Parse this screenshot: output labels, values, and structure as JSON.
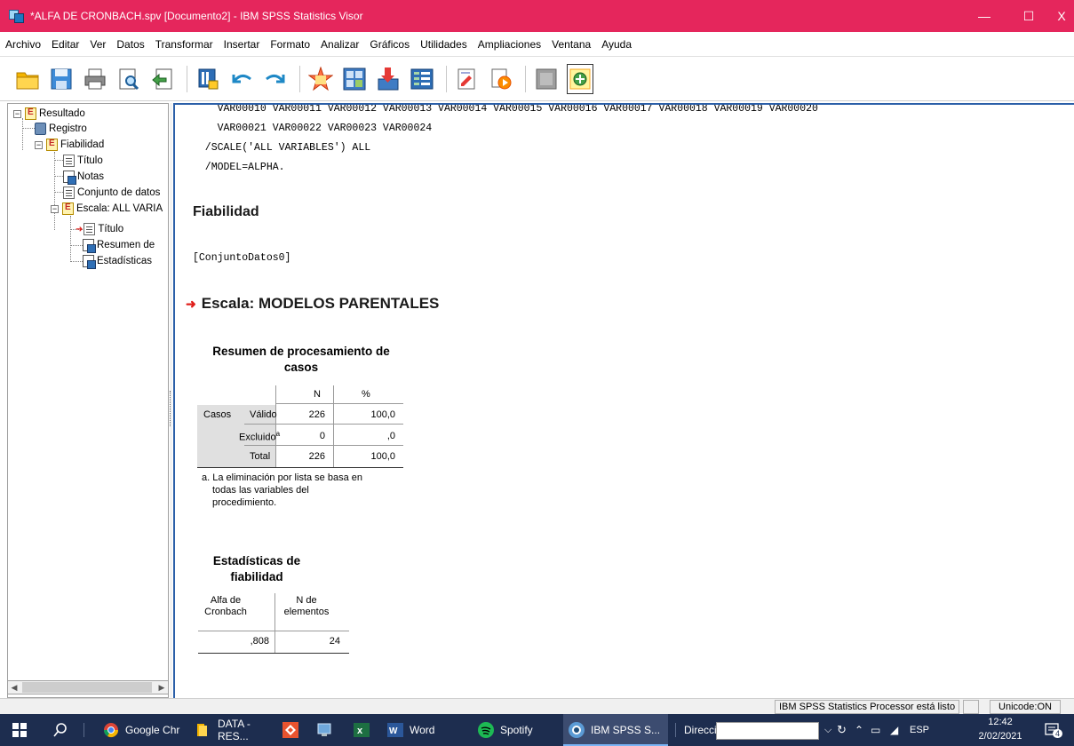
{
  "window": {
    "title": "*ALFA DE CRONBACH.spv [Documento2] - IBM SPSS Statistics Visor",
    "controls": {
      "minimize": "—",
      "maximize": "☐",
      "close": "X"
    }
  },
  "menu": [
    "Archivo",
    "Editar",
    "Ver",
    "Datos",
    "Transformar",
    "Insertar",
    "Formato",
    "Analizar",
    "Gráficos",
    "Utilidades",
    "Ampliaciones",
    "Ventana",
    "Ayuda"
  ],
  "toolbar_icons": [
    "open-icon",
    "save-icon",
    "print-icon",
    "print-preview-icon",
    "export-icon",
    "recall-dialog-icon",
    "undo-icon",
    "redo-icon",
    "goto-data-icon",
    "goto-case-icon",
    "insert-output-icon",
    "variables-icon",
    "designate-window-icon",
    "select-last-output-icon",
    "inactive-icon",
    "show-hide-icon"
  ],
  "outline": {
    "root": "Resultado",
    "log": "Registro",
    "procedure": "Fiabilidad",
    "titulo": "Título",
    "notas": "Notas",
    "dataset": "Conjunto de datos",
    "scale": "Escala: ALL VARIA",
    "scale_title": "Título",
    "summary": "Resumen de",
    "stats": "Estadísticas"
  },
  "content": {
    "syntax_lines": [
      "    VAR00010 VAR00011 VAR00012 VAR00013 VAR00014 VAR00015 VAR00016 VAR00017 VAR00018 VAR00019 VAR00020",
      "    VAR00021 VAR00022 VAR00023 VAR00024",
      "  /SCALE('ALL VARIABLES') ALL",
      "  /MODEL=ALPHA."
    ],
    "heading": "Fiabilidad",
    "dataset_label": "[ConjuntoDatos0]",
    "scale_heading": "Escala: MODELOS PARENTALES",
    "case_summary": {
      "title_line1": "Resumen de procesamiento de",
      "title_line2": "casos",
      "col_n": "N",
      "col_pct": "%",
      "row_group": "Casos",
      "rows": [
        {
          "label": "Válido",
          "n": "226",
          "pct": "100,0"
        },
        {
          "label": "Excluido",
          "sup": "a",
          "n": "0",
          "pct": ",0"
        },
        {
          "label": "Total",
          "n": "226",
          "pct": "100,0"
        }
      ],
      "footnote_line1": "a. La eliminación por lista se basa en",
      "footnote_line2": "todas las variables del",
      "footnote_line3": "procedimiento."
    },
    "reliability": {
      "title_line1": "Estadísticas de",
      "title_line2": "fiabilidad",
      "col1_line1": "Alfa de",
      "col1_line2": "Cronbach",
      "col2_line1": "N de",
      "col2_line2": "elementos",
      "alpha": ",808",
      "n_items": "24"
    }
  },
  "status": {
    "processor": "IBM SPSS Statistics Processor está listo",
    "unicode": "Unicode:ON"
  },
  "taskbar": {
    "apps": [
      "Google Chr",
      "DATA - RES...",
      "Word",
      "Spotify",
      "IBM SPSS S..."
    ],
    "address_label": "Dirección",
    "lang": "ESP",
    "time": "12:42",
    "date": "2/02/2021",
    "notif_count": "4"
  }
}
